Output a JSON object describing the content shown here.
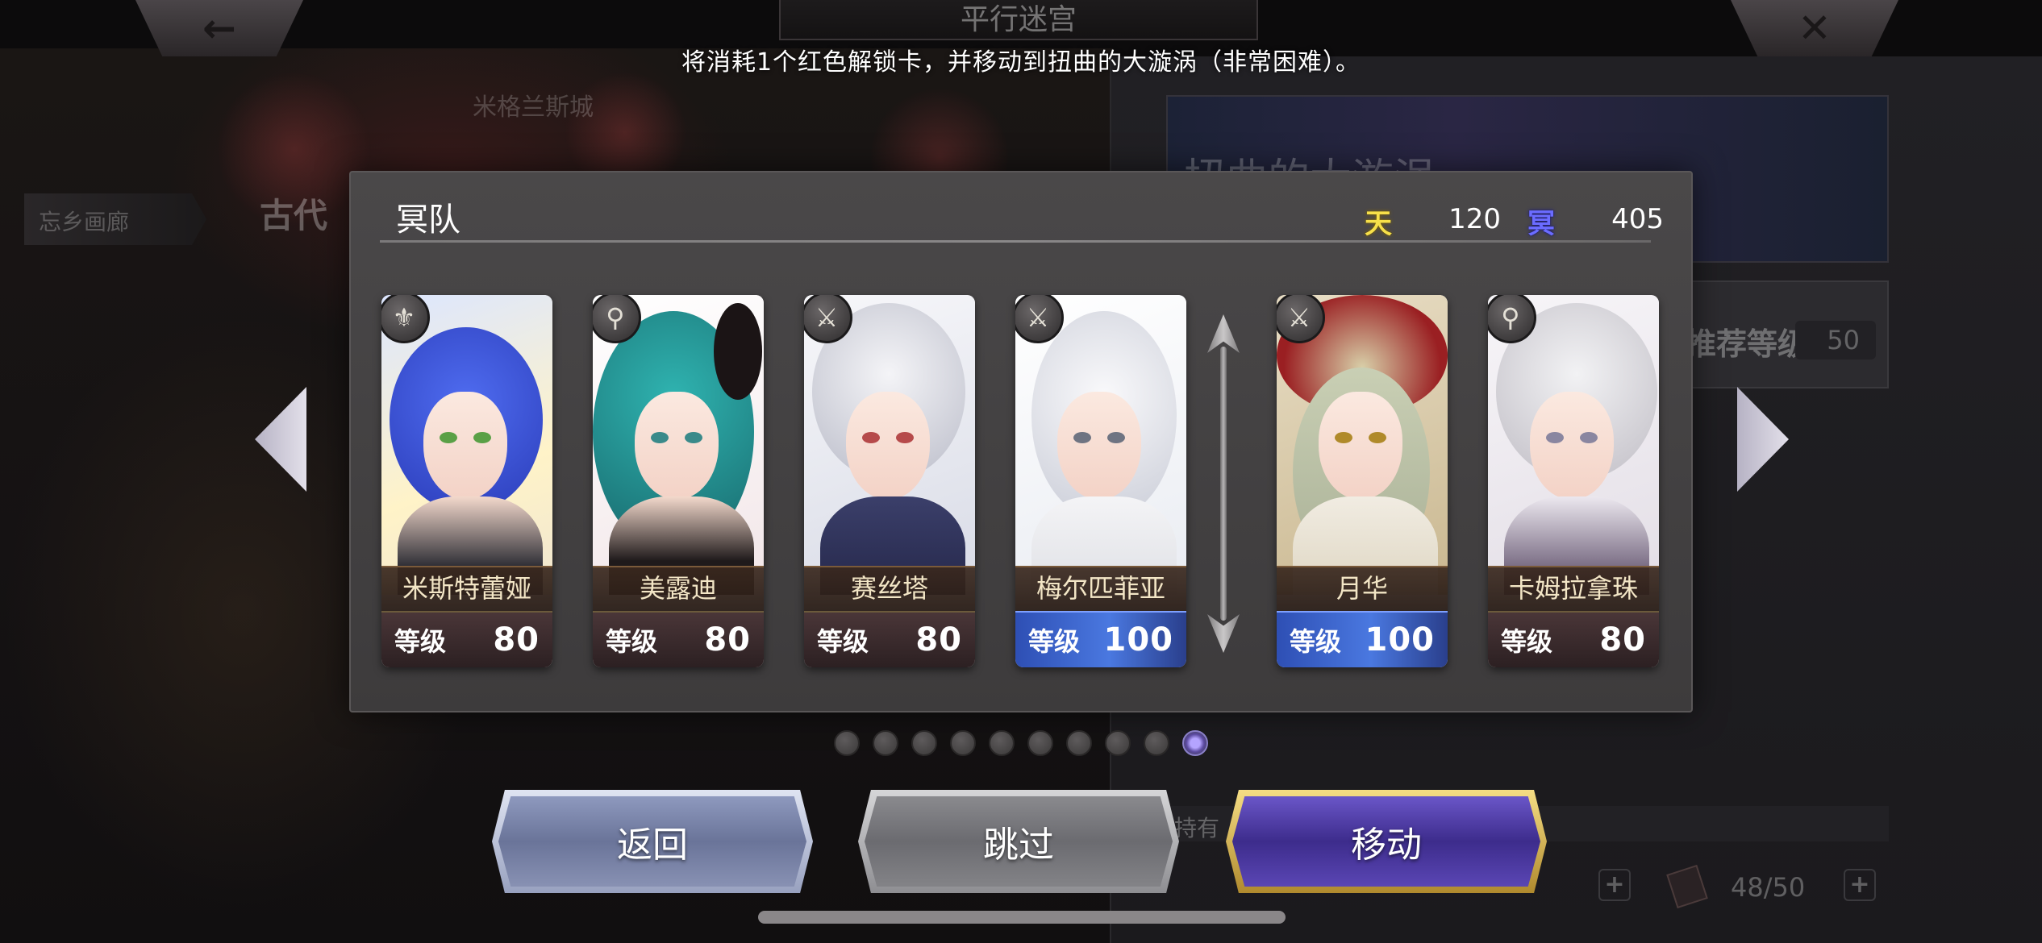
{
  "header": {
    "back_icon": "←",
    "close_icon": "✕",
    "title": "平行迷宫",
    "message": "将消耗1个红色解锁卡，并移动到扭曲的大漩涡（非常困难）。"
  },
  "background": {
    "era_label": "古代",
    "sub_label": "米格兰斯城",
    "side_tab": "忘乡画廊",
    "banner_title": "扭曲的大漩涡",
    "recommended_level_label": "推荐等级",
    "recommended_level_value": "50",
    "hold_label": "持有",
    "ticket_count": "48/50",
    "plus_symbol": "+"
  },
  "modal": {
    "team_name": "冥队",
    "stats": {
      "heaven_icon": "天",
      "heaven_value": "120",
      "hell_icon": "冥",
      "hell_value": "405"
    }
  },
  "characters": [
    {
      "name": "米斯特蕾娅",
      "level_label": "等级",
      "level": "80",
      "weapon_icon": "bow-icon",
      "weapon_glyph": "⚜"
    },
    {
      "name": "美露迪",
      "level_label": "等级",
      "level": "80",
      "weapon_icon": "staff-icon",
      "weapon_glyph": "⚲"
    },
    {
      "name": "赛丝塔",
      "level_label": "等级",
      "level": "80",
      "weapon_icon": "sword-icon",
      "weapon_glyph": "⚔"
    },
    {
      "name": "梅尔匹菲亚",
      "level_label": "等级",
      "level": "100",
      "weapon_icon": "sword-icon",
      "weapon_glyph": "⚔"
    },
    {
      "name": "月华",
      "level_label": "等级",
      "level": "100",
      "weapon_icon": "sword-icon",
      "weapon_glyph": "⚔"
    },
    {
      "name": "卡姆拉拿珠",
      "level_label": "等级",
      "level": "80",
      "weapon_icon": "staff-icon",
      "weapon_glyph": "⚲"
    }
  ],
  "pagination": {
    "total": 10,
    "current": 10
  },
  "buttons": {
    "back": "返回",
    "skip": "跳过",
    "move": "移动"
  },
  "colors": {
    "level_high": "#4a78e0",
    "move_button": "#3d2c8c",
    "heaven": "#f7e04a",
    "hell": "#6b6cff"
  }
}
